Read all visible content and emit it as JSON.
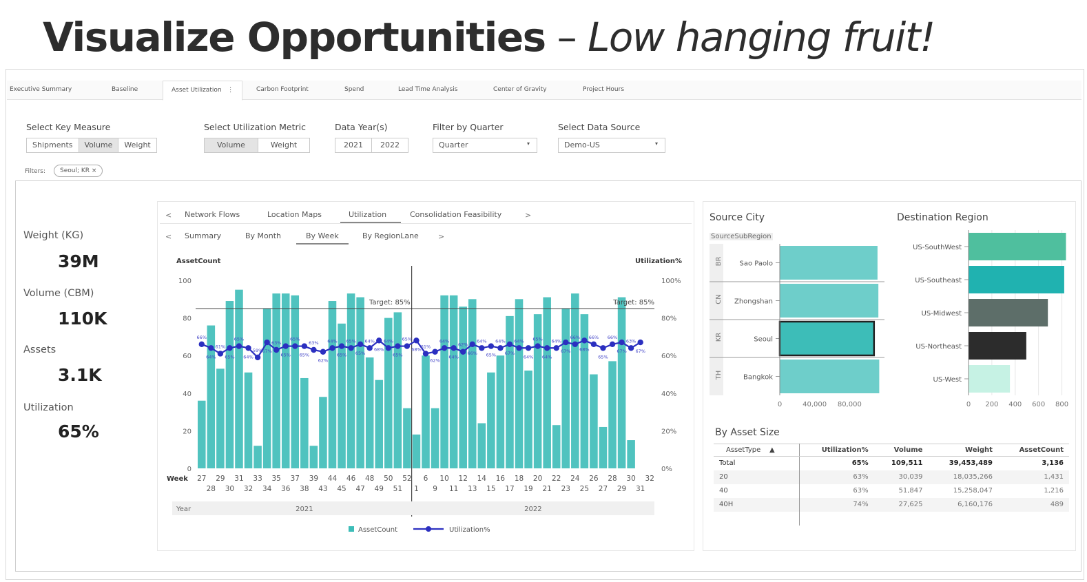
{
  "slide": {
    "title_bold": "Visualize Opportunities",
    "title_dash": " – ",
    "title_italic": "Low hanging fruit!"
  },
  "tabs": [
    {
      "label": "Executive Summary"
    },
    {
      "label": "Baseline"
    },
    {
      "label": "Asset Utilization",
      "active": true
    },
    {
      "label": "Carbon Footprint"
    },
    {
      "label": "Spend"
    },
    {
      "label": "Lead Time Analysis"
    },
    {
      "label": "Center of Gravity"
    },
    {
      "label": "Project Hours"
    }
  ],
  "tab_menu_glyph": "⋮",
  "controls": {
    "key_measure": {
      "label": "Select Key Measure",
      "options": [
        "Shipments",
        "Volume",
        "Weight"
      ],
      "selected": "Volume"
    },
    "util_metric": {
      "label": "Select Utilization Metric",
      "options": [
        "Volume",
        "Weight"
      ],
      "selected": "Volume"
    },
    "data_years": {
      "label": "Data Year(s)",
      "options": [
        "2021",
        "2022"
      ]
    },
    "quarter": {
      "label": "Filter by Quarter",
      "value": "Quarter"
    },
    "source": {
      "label": "Select Data Source",
      "value": "Demo-US"
    },
    "caret": "▾"
  },
  "filters": {
    "label": "Filters:",
    "chip": "Seoul; KR ×"
  },
  "kpis": [
    {
      "label": "Weight (KG)",
      "value": "39M"
    },
    {
      "label": "Volume (CBM)",
      "value": "110K"
    },
    {
      "label": "Assets",
      "value": "3.1K"
    },
    {
      "label": "Utilization",
      "value": "65%"
    }
  ],
  "subtabs_top": [
    "Network Flows",
    "Location Maps",
    "Utilization",
    "Consolidation Feasibility"
  ],
  "subtabs_top_active": "Utilization",
  "subtabs_bottom": [
    "Summary",
    "By Month",
    "By Week",
    "By RegionLane"
  ],
  "subtabs_bottom_active": "By Week",
  "nav": {
    "prev": "<",
    "next": ">"
  },
  "colors": {
    "teal": "#3dbdb8",
    "navy": "#2b2fc0",
    "mid": "#555555"
  },
  "chart_data": [
    {
      "type": "bar",
      "title": "",
      "ylabel": "AssetCount",
      "y2label": "Utilization%",
      "xlabel": "Week",
      "year_label": "Year",
      "ylim": [
        0,
        100
      ],
      "y_ticks": [
        0,
        20,
        40,
        60,
        80,
        100
      ],
      "y2_ticks": [
        "0%",
        "20%",
        "40%",
        "60%",
        "80%",
        "100%"
      ],
      "target_label": "Target: 85%",
      "target_value": 85,
      "groups": [
        {
          "year": "2021",
          "weeks": [
            "27",
            "28",
            "29",
            "30",
            "31",
            "32",
            "33",
            "34",
            "35",
            "36",
            "37",
            "38",
            "39",
            "43",
            "44",
            "45",
            "46",
            "47",
            "48",
            "49",
            "50",
            "51",
            "52"
          ]
        },
        {
          "year": "2022",
          "weeks": [
            "1",
            "6",
            "9",
            "10",
            "11",
            "12",
            "13",
            "14",
            "15",
            "16",
            "17",
            "18",
            "19",
            "20",
            "21",
            "22",
            "23",
            "24",
            "25",
            "26",
            "27",
            "28",
            "29",
            "30",
            "31",
            "32"
          ]
        }
      ],
      "series": [
        {
          "name": "AssetCount",
          "values": [
            36,
            76,
            53,
            89,
            95,
            51,
            12,
            85,
            93,
            93,
            92,
            48,
            12,
            38,
            89,
            77,
            93,
            91,
            59,
            47,
            80,
            83,
            32,
            18,
            60,
            32,
            92,
            92,
            86,
            90,
            24,
            51,
            60,
            81,
            90,
            52,
            82,
            91,
            23,
            85,
            93,
            82,
            50,
            22,
            57,
            91,
            15
          ]
        },
        {
          "name": "Utilization%",
          "values": [
            66,
            64,
            61,
            64,
            65,
            64,
            59,
            67,
            63,
            65,
            65,
            65,
            63,
            62,
            64,
            65,
            64,
            66,
            64,
            68,
            64,
            65,
            65,
            68,
            61,
            62,
            64,
            64,
            62,
            66,
            64,
            65,
            64,
            66,
            64,
            64,
            65,
            64,
            64,
            67,
            66,
            68,
            66,
            64,
            66,
            67,
            64,
            67
          ]
        }
      ],
      "point_labels": [
        "66%",
        "64%",
        "61%",
        "65%",
        "65%",
        "64%",
        "59%",
        "67%",
        "63%",
        "65%",
        "65%",
        "65%",
        "63%",
        "62%",
        "64%",
        "65%",
        "65%",
        "65%",
        "64%",
        "68%",
        "64%",
        "65%",
        "65%",
        "68%",
        "61%",
        "62%",
        "64%",
        "64%",
        "62%",
        "66%",
        "64%",
        "65%",
        "64%",
        "67%",
        "64%",
        "64%",
        "65%",
        "64%",
        "64%",
        "67%",
        "66%",
        "68%",
        "66%",
        "65%",
        "66%",
        "67%",
        "63%",
        "67%"
      ],
      "legend": [
        "AssetCount",
        "Utilization%"
      ]
    },
    {
      "type": "bar",
      "title": "Source City",
      "subtitle": "SourceSubRegion",
      "orientation": "horizontal",
      "categories": [
        "Sao Paolo",
        "Zhongshan",
        "Seoul",
        "Bangkok"
      ],
      "groups": [
        "BR",
        "CN",
        "KR",
        "TH"
      ],
      "values": [
        112000,
        113000,
        108000,
        114000
      ],
      "selected": "Seoul",
      "x_ticks": [
        "0",
        "40,000",
        "80,000"
      ],
      "xlim": [
        0,
        120000
      ]
    },
    {
      "type": "bar",
      "title": "Destination Region",
      "orientation": "horizontal",
      "categories": [
        "US-SouthWest",
        "US-Southeast",
        "US-Midwest",
        "US-Northeast",
        "US-West"
      ],
      "values": [
        835,
        820,
        680,
        495,
        355
      ],
      "colors": [
        "#4fbf9e",
        "#20b2b0",
        "#5d6e69",
        "#2c2c2c",
        "#c6f2e4"
      ],
      "x_ticks": [
        "0",
        "200",
        "400",
        "600",
        "800"
      ],
      "xlim": [
        0,
        850
      ]
    }
  ],
  "asset_table": {
    "title": "By Asset Size",
    "columns": [
      "AssetType",
      "Utilization%",
      "Volume",
      "Weight",
      "AssetCount"
    ],
    "sort_glyph": "▲",
    "rows": [
      [
        "Total",
        "65%",
        "109,511",
        "39,453,489",
        "3,136"
      ],
      [
        "20",
        "63%",
        "30,039",
        "18,035,266",
        "1,431"
      ],
      [
        "40",
        "63%",
        "51,847",
        "15,258,047",
        "1,216"
      ],
      [
        "40H",
        "74%",
        "27,625",
        "6,160,176",
        "489"
      ],
      [
        "",
        "",
        "",
        "",
        ""
      ]
    ]
  }
}
